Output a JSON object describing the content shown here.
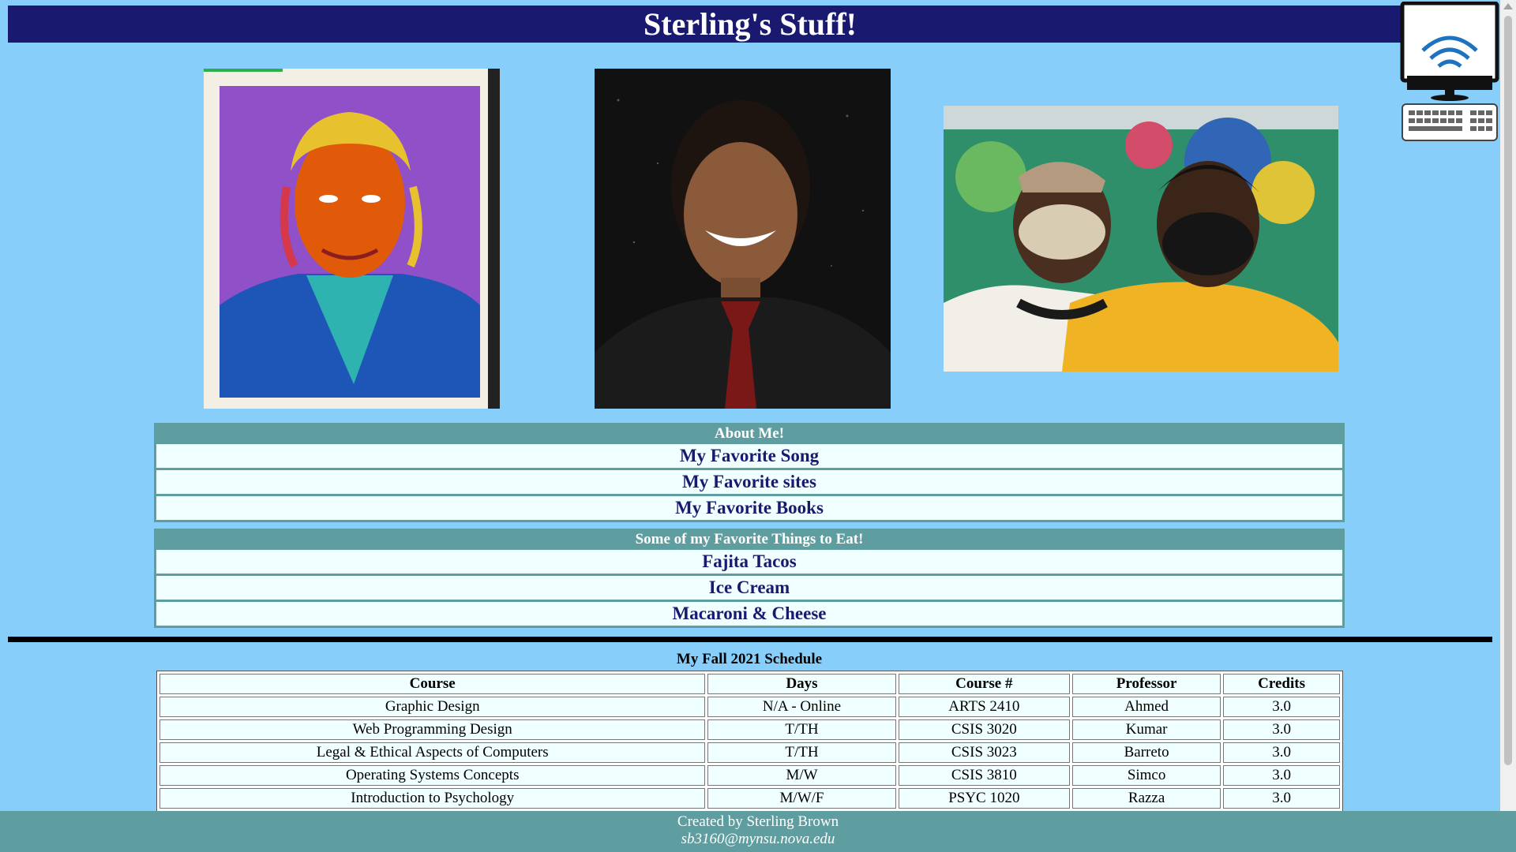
{
  "header": {
    "title": "Sterling's Stuff!"
  },
  "images": {
    "photo1": "self-portrait painting",
    "photo2": "portrait photo",
    "photo3": "friends selfie in front of mural",
    "pc": "computer-wifi-icon"
  },
  "about": {
    "title": "About Me!",
    "items": [
      "My Favorite Song",
      "My Favorite sites",
      "My Favorite Books"
    ]
  },
  "food": {
    "title": "Some of my Favorite Things to Eat!",
    "items": [
      "Fajita Tacos",
      "Ice Cream",
      "Macaroni & Cheese"
    ]
  },
  "schedule": {
    "caption": "My Fall 2021 Schedule",
    "headers": [
      "Course",
      "Days",
      "Course #",
      "Professor",
      "Credits"
    ],
    "rows": [
      [
        "Graphic Design",
        "N/A - Online",
        "ARTS 2410",
        "Ahmed",
        "3.0"
      ],
      [
        "Web Programming Design",
        "T/TH",
        "CSIS 3020",
        "Kumar",
        "3.0"
      ],
      [
        "Legal & Ethical Aspects of Computers",
        "T/TH",
        "CSIS 3023",
        "Barreto",
        "3.0"
      ],
      [
        "Operating Systems Concepts",
        "M/W",
        "CSIS 3810",
        "Simco",
        "3.0"
      ],
      [
        "Introduction to Psychology",
        "M/W/F",
        "PSYC 1020",
        "Razza",
        "3.0"
      ]
    ]
  },
  "footer": {
    "created_by": "Created by Sterling Brown",
    "email": "sb3160@mynsu.nova.edu"
  },
  "colors": {
    "background": "#87cefa",
    "header": "#191970",
    "accent": "#5f9ea0",
    "item_bg": "#f0ffff"
  }
}
